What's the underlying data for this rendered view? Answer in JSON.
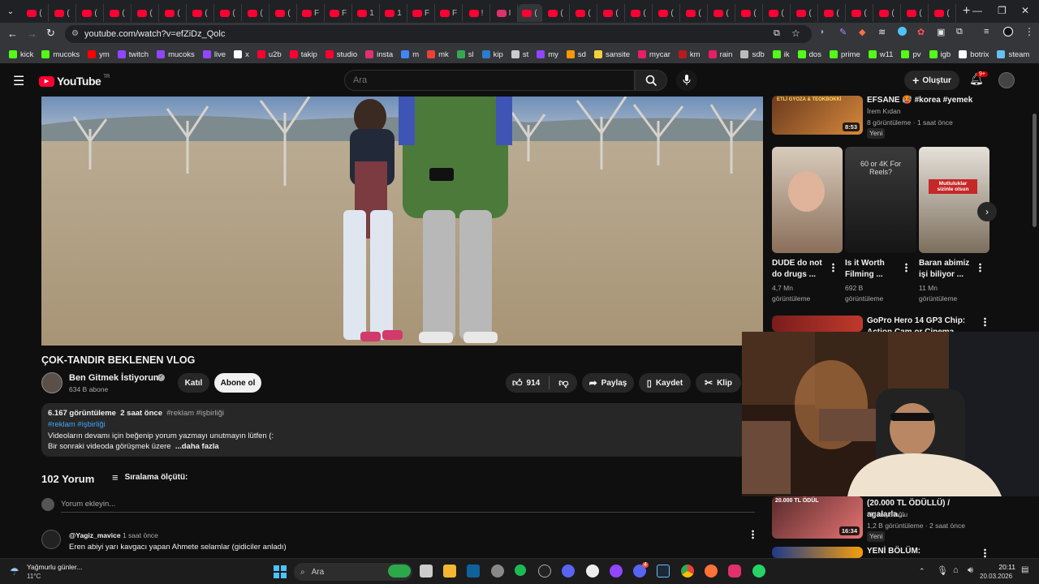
{
  "browser": {
    "url": "youtube.com/watch?v=efZiDz_Qolc",
    "tab_glyphs": [
      "(",
      "(",
      "(",
      "(",
      "(",
      "(",
      "(",
      "(",
      "(",
      "(",
      "F",
      "F",
      "1",
      "1",
      "F",
      "F",
      "!",
      "I",
      "(",
      "(",
      "(",
      "(",
      "(",
      "(",
      "(",
      "(",
      "(",
      "(",
      "(",
      "(",
      "(",
      "(",
      "(",
      "("
    ],
    "new_tab": "+",
    "bookmarks": [
      {
        "label": "kick",
        "color": "#53fc18"
      },
      {
        "label": "mucoks",
        "color": "#53fc18"
      },
      {
        "label": "ym",
        "color": "#ff0000"
      },
      {
        "label": "twitch",
        "color": "#9146ff"
      },
      {
        "label": "mucoks",
        "color": "#9146ff"
      },
      {
        "label": "live",
        "color": "#9146ff"
      },
      {
        "label": "x",
        "color": "#ffffff"
      },
      {
        "label": "u2b",
        "color": "#ff0033"
      },
      {
        "label": "takip",
        "color": "#ff0033"
      },
      {
        "label": "studio",
        "color": "#ff0033"
      },
      {
        "label": "insta",
        "color": "#e1306c"
      },
      {
        "label": "m",
        "color": "#4285f4"
      },
      {
        "label": "mk",
        "color": "#ea4335"
      },
      {
        "label": "sl",
        "color": "#34a853"
      },
      {
        "label": "kip",
        "color": "#2e7bcf"
      },
      {
        "label": "st",
        "color": "#cccccc"
      },
      {
        "label": "my",
        "color": "#9146ff"
      },
      {
        "label": "sd",
        "color": "#ff9900"
      },
      {
        "label": "sansite",
        "color": "#f4d03f"
      },
      {
        "label": "mycar",
        "color": "#e91e63"
      },
      {
        "label": "km",
        "color": "#b71c1c"
      },
      {
        "label": "rain",
        "color": "#e91e63"
      },
      {
        "label": "sdb",
        "color": "#bbbbbb"
      },
      {
        "label": "ik",
        "color": "#53fc18"
      },
      {
        "label": "dos",
        "color": "#53fc18"
      },
      {
        "label": "prime",
        "color": "#53fc18"
      },
      {
        "label": "w11",
        "color": "#53fc18"
      },
      {
        "label": "pv",
        "color": "#53fc18"
      },
      {
        "label": "igb",
        "color": "#53fc18"
      },
      {
        "label": "botrix",
        "color": "#ffffff"
      },
      {
        "label": "steam",
        "color": "#66c0f4"
      }
    ]
  },
  "youtube": {
    "logo_text": "YouTube",
    "logo_region": "TR",
    "search_placeholder": "Ara",
    "create_label": "Oluştur",
    "notif_count": "9+"
  },
  "video": {
    "title": "ÇOK-TANDIR BEKLENEN VLOG",
    "channel": "Ben Gitmek İstiyorum.",
    "subscribers": "634 B abone",
    "join_label": "Katıl",
    "subscribe_label": "Abone ol",
    "likes": "914",
    "share_label": "Paylaş",
    "save_label": "Kaydet",
    "clip_label": "Klip",
    "views": "6.167 görüntüleme",
    "age": "2 saat önce",
    "tags": "#reklam #işbirliği",
    "desc_line1": "Videoların devamı için beğenip yorum yazmayı unutmayın lütfen (:",
    "desc_line2": "Bir sonraki videoda görüşmek üzere",
    "more_label": "...daha fazla"
  },
  "comments": {
    "count": "102 Yorum",
    "sort_label": "Sıralama ölçütü:",
    "add_placeholder": "Yorum ekleyin...",
    "first": {
      "author": "@Yagiz_mavice",
      "time": "1 saat önce",
      "text": "Eren abiyi yarı kavgacı yapan Ahmete selamlar (gidiciler anladı)"
    }
  },
  "sidebar": {
    "top": {
      "title": "EFSANE 🥵 #korea #yemek",
      "channel": "İrem Kıdan",
      "meta": "8 görüntüleme · 1 saat önce",
      "badge": "Yeni",
      "duration": "8:53",
      "thumb_text": "ETLİ GYOZA & TEOKBOKKİ"
    },
    "shorts": [
      {
        "title": "DUDE do not do drugs ...",
        "views": "4,7 Mn görüntüleme"
      },
      {
        "title": "Is it Worth Filming ...",
        "views": "692 B görüntüleme",
        "thumb_text": "60 or 4K For Reels?"
      },
      {
        "title": "Baran abimiz işi biliyor ...",
        "views": "11 Mn görüntüleme",
        "thumb_text": "Mutluluklar sizinle olsun"
      }
    ],
    "gopro": {
      "title": "GoPro Hero 14 GP3 Chip: Action Cam or Cinema Vlogging Must ..."
    },
    "bottom1": {
      "title": "(20.000 TL ÖDÜLLÜ) / agalarla...",
      "channel": "alp hayaloğlu",
      "meta": "1,2 B görüntüleme · 2 saat önce",
      "badge": "Yeni",
      "duration": "16:34",
      "thumb_text": "20.000 TL ÖDÜL"
    },
    "bottom2": {
      "title": "YENİ BÖLÜM:"
    }
  },
  "taskbar": {
    "weather_title": "Yağmurlu günler...",
    "weather_temp": "11°C",
    "search_label": "Ara",
    "time": "20:11",
    "date": "20.03.2026",
    "steam_badge": "4"
  }
}
